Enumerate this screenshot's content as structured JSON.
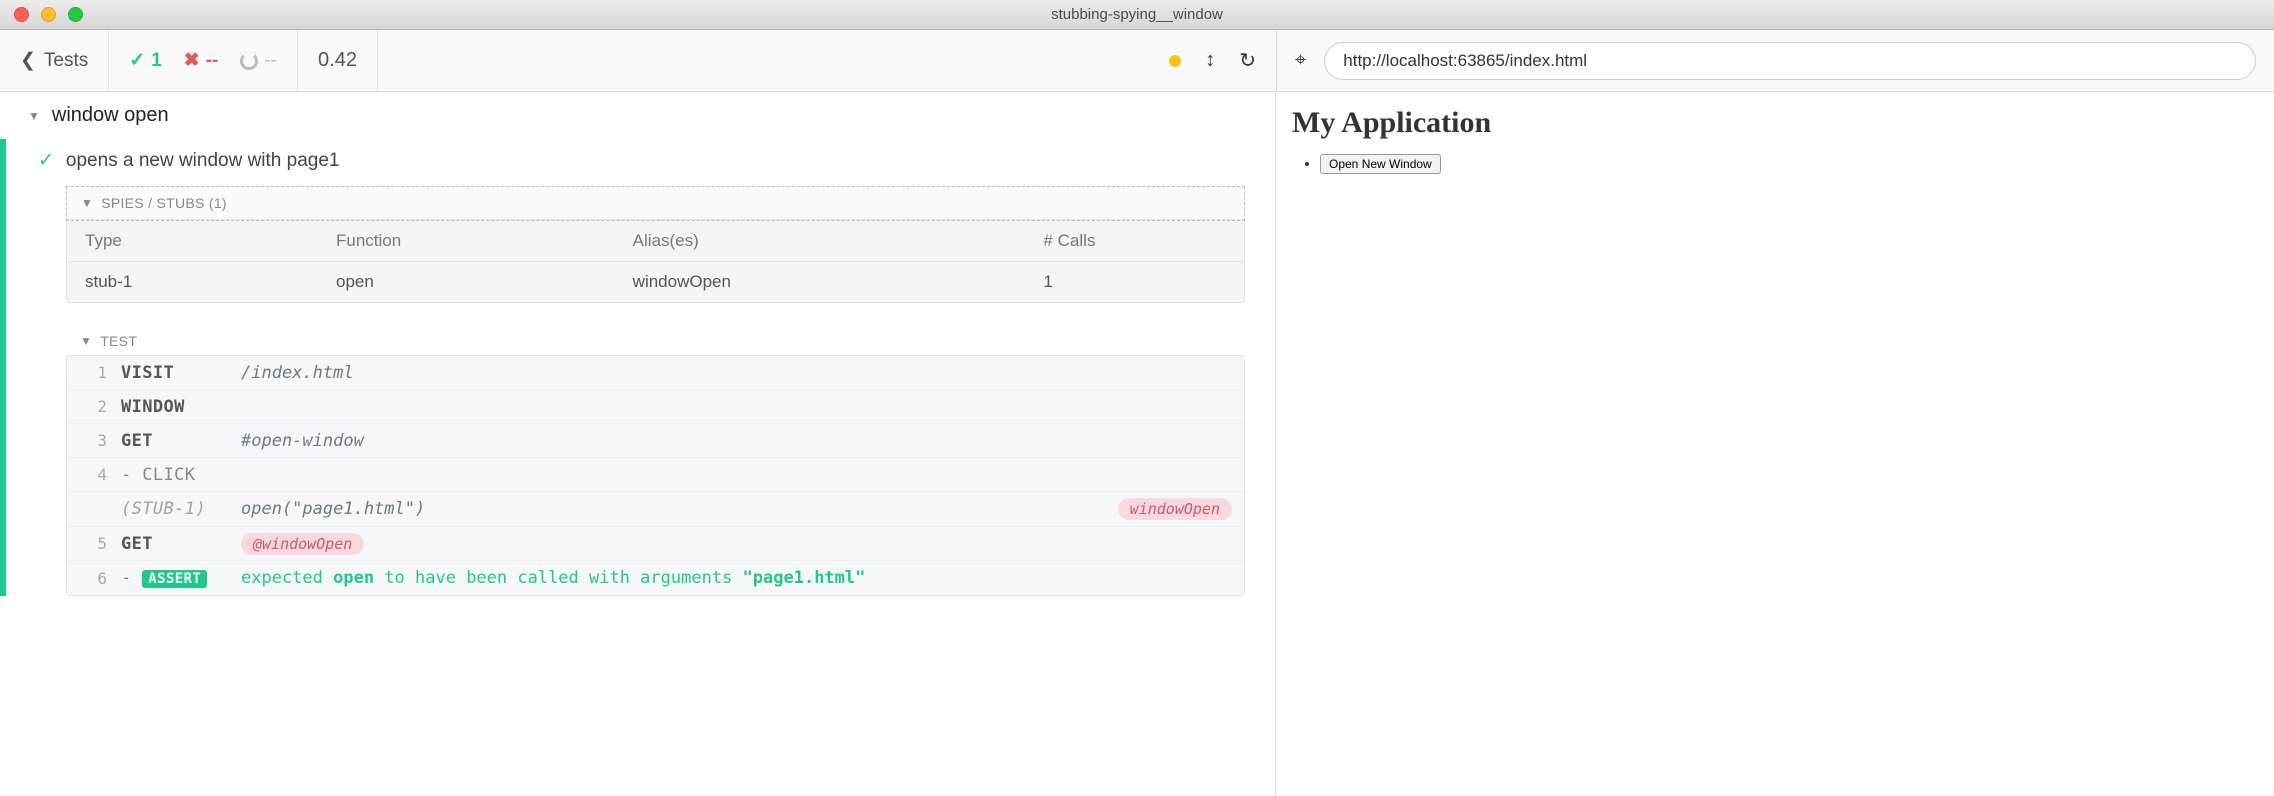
{
  "window": {
    "title": "stubbing-spying__window"
  },
  "toolbar": {
    "back_label": "Tests",
    "passed": "1",
    "failed": "--",
    "pending": "--",
    "duration": "0.42",
    "url": "http://localhost:63865/index.html"
  },
  "suite": {
    "name": "window open"
  },
  "test": {
    "name": "opens a new window with page1"
  },
  "spies": {
    "header": "SPIES / STUBS (1)",
    "columns": {
      "type": "Type",
      "fn": "Function",
      "alias": "Alias(es)",
      "calls": "# Calls"
    },
    "rows": [
      {
        "type": "stub-1",
        "fn": "open",
        "alias": "windowOpen",
        "calls": "1"
      }
    ]
  },
  "cmdlog": {
    "header": "TEST",
    "rows": [
      {
        "num": "1",
        "name": "VISIT",
        "msg": "/index.html"
      },
      {
        "num": "2",
        "name": "WINDOW",
        "msg": ""
      },
      {
        "num": "3",
        "name": "GET",
        "msg": "#open-window"
      },
      {
        "num": "4",
        "name": " - CLICK",
        "msg": ""
      },
      {
        "num": "",
        "name": "(STUB-1)",
        "msg": "open(\"page1.html\")",
        "pill": "windowOpen",
        "stub": true
      },
      {
        "num": "5",
        "name": "GET",
        "pillInline": "@windowOpen"
      },
      {
        "num": "6",
        "name": " - ",
        "assert": "ASSERT",
        "assertMsg": [
          "expected ",
          "open",
          " to have been called with arguments ",
          "\"page1.html\""
        ]
      }
    ]
  },
  "app": {
    "heading": "My Application",
    "button": "Open New Window"
  }
}
